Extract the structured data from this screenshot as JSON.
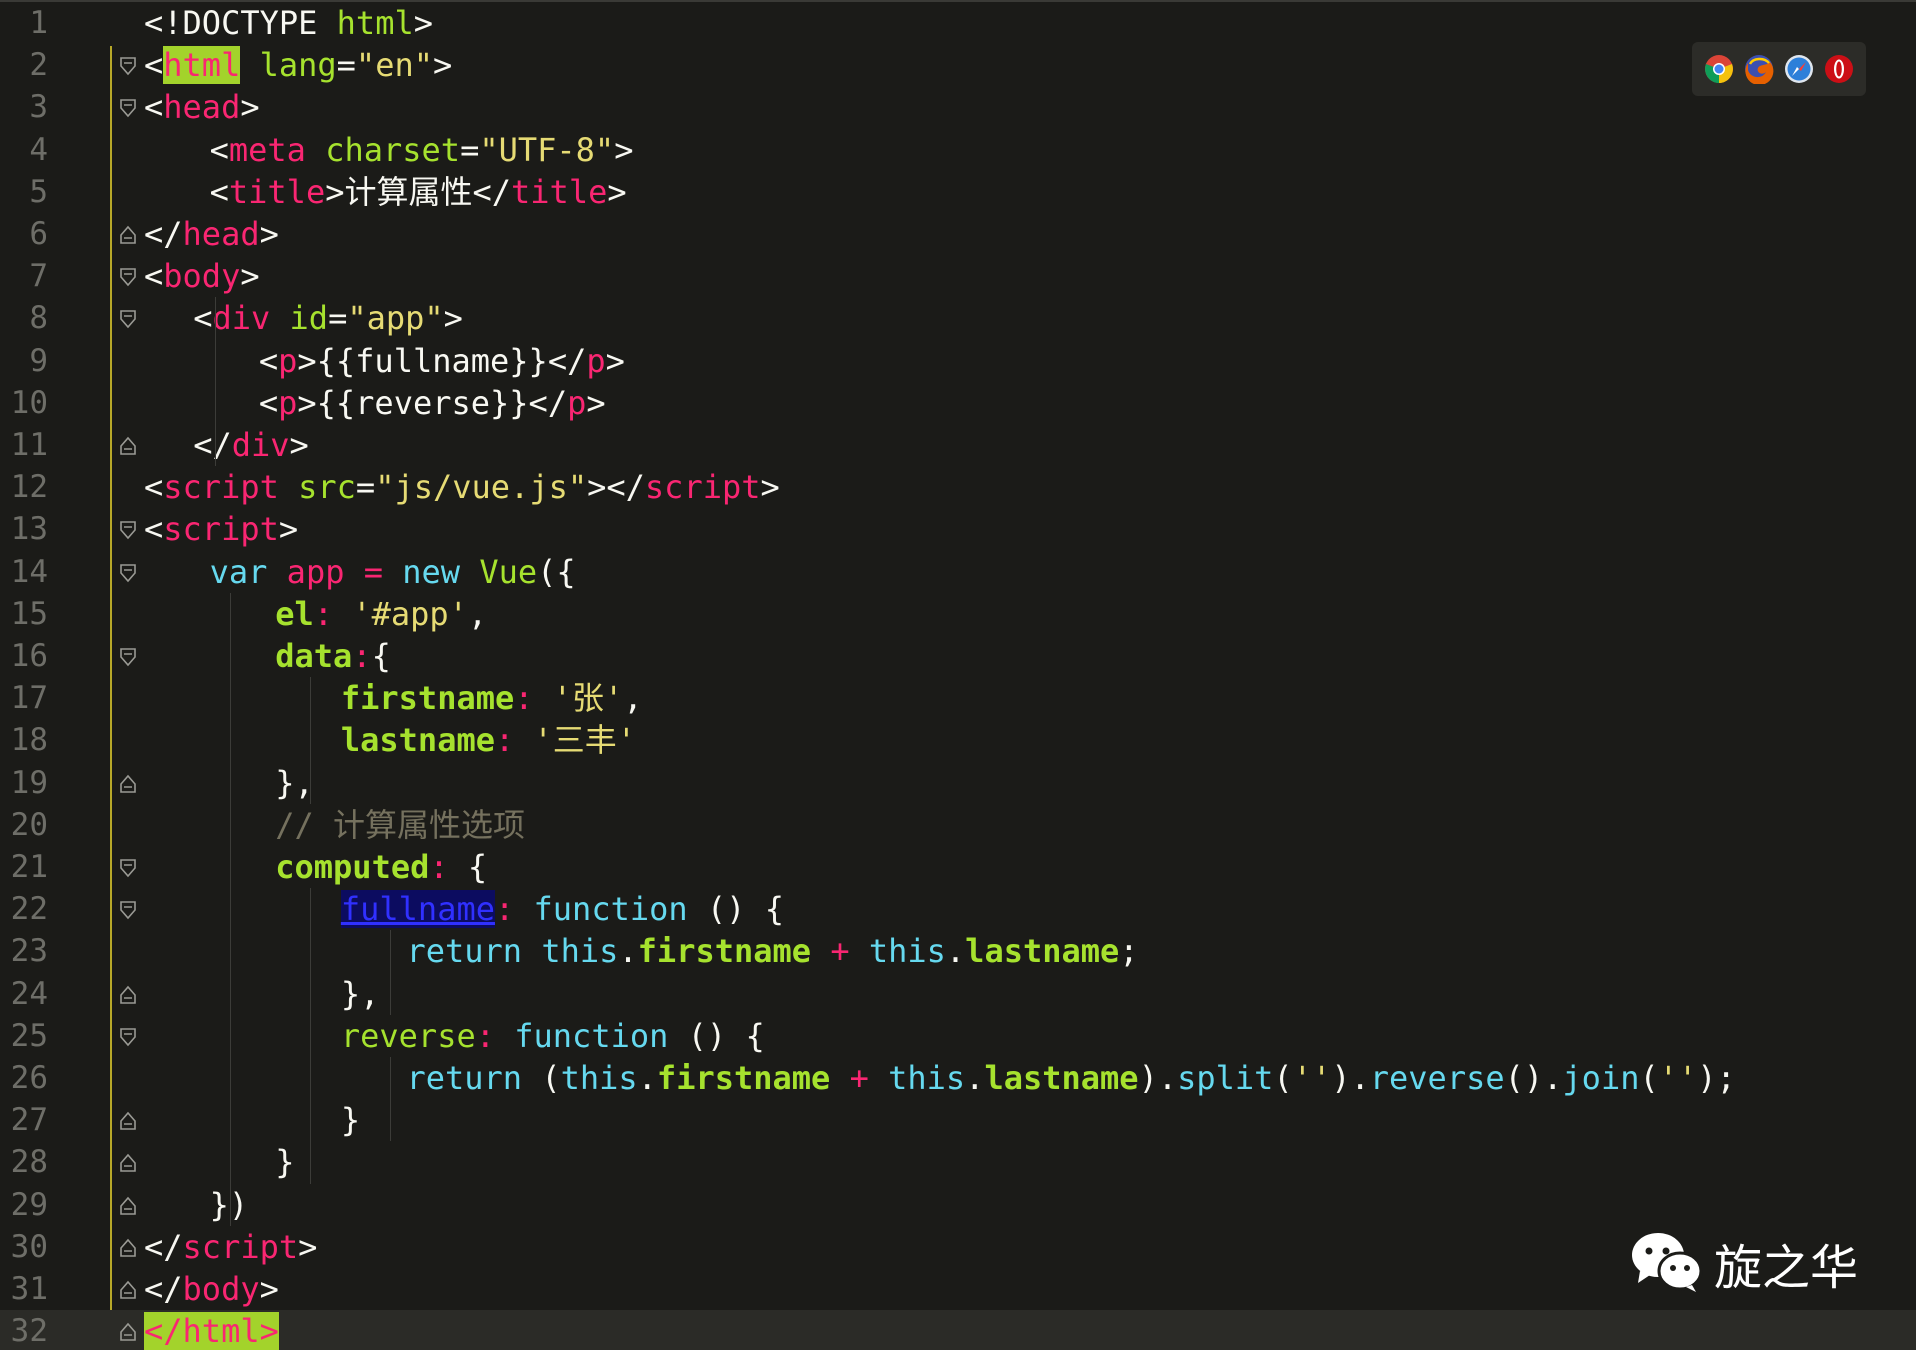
{
  "editor": {
    "current_line": 32,
    "colors": {
      "background": "#1b1b18",
      "tag": "#f92672",
      "attribute": "#a6e22e",
      "string": "#e6db74",
      "keyword": "#66d9ef",
      "comment": "#75715e"
    },
    "lines": [
      {
        "n": "1",
        "fold": "none",
        "indent": 0,
        "tokens": [
          [
            "punc",
            "<!DOCTYPE "
          ],
          [
            "attr",
            "html"
          ],
          [
            "punc",
            ">"
          ]
        ]
      },
      {
        "n": "2",
        "fold": "open",
        "indent": 0,
        "tokens": [
          [
            "punc",
            "<"
          ],
          [
            "hltag",
            "html"
          ],
          [
            "punc",
            " "
          ],
          [
            "attr",
            "lang"
          ],
          [
            "punc",
            "="
          ],
          [
            "str",
            "\"en\""
          ],
          [
            "punc",
            ">"
          ]
        ]
      },
      {
        "n": "3",
        "fold": "open",
        "indent": 0,
        "tokens": [
          [
            "punc",
            "<"
          ],
          [
            "tag",
            "head"
          ],
          [
            "punc",
            ">"
          ]
        ]
      },
      {
        "n": "4",
        "fold": "none",
        "indent": 2,
        "tokens": [
          [
            "punc",
            "<"
          ],
          [
            "tag",
            "meta"
          ],
          [
            "punc",
            " "
          ],
          [
            "attr",
            "charset"
          ],
          [
            "punc",
            "="
          ],
          [
            "str",
            "\"UTF-8\""
          ],
          [
            "punc",
            ">"
          ]
        ]
      },
      {
        "n": "5",
        "fold": "none",
        "indent": 2,
        "tokens": [
          [
            "punc",
            "<"
          ],
          [
            "tag",
            "title"
          ],
          [
            "punc",
            ">计算属性</"
          ],
          [
            "tag",
            "title"
          ],
          [
            "punc",
            ">"
          ]
        ]
      },
      {
        "n": "6",
        "fold": "close",
        "indent": 0,
        "tokens": [
          [
            "punc",
            "</"
          ],
          [
            "tag",
            "head"
          ],
          [
            "punc",
            ">"
          ]
        ]
      },
      {
        "n": "7",
        "fold": "open",
        "indent": 0,
        "tokens": [
          [
            "punc",
            "<"
          ],
          [
            "tag",
            "body"
          ],
          [
            "punc",
            ">"
          ]
        ]
      },
      {
        "n": "8",
        "fold": "open",
        "indent": 1.5,
        "tokens": [
          [
            "punc",
            "<"
          ],
          [
            "tag",
            "div"
          ],
          [
            "punc",
            " "
          ],
          [
            "attr",
            "id"
          ],
          [
            "punc",
            "="
          ],
          [
            "str",
            "\"app\""
          ],
          [
            "punc",
            ">"
          ]
        ]
      },
      {
        "n": "9",
        "fold": "none",
        "indent": 3.5,
        "tokens": [
          [
            "punc",
            "<"
          ],
          [
            "tag",
            "p"
          ],
          [
            "punc",
            ">{{fullname}}</"
          ],
          [
            "tag",
            "p"
          ],
          [
            "punc",
            ">"
          ]
        ]
      },
      {
        "n": "10",
        "fold": "none",
        "indent": 3.5,
        "tokens": [
          [
            "punc",
            "<"
          ],
          [
            "tag",
            "p"
          ],
          [
            "punc",
            ">{{reverse}}</"
          ],
          [
            "tag",
            "p"
          ],
          [
            "punc",
            ">"
          ]
        ]
      },
      {
        "n": "11",
        "fold": "close",
        "indent": 1.5,
        "tokens": [
          [
            "punc",
            "</"
          ],
          [
            "tag",
            "div"
          ],
          [
            "punc",
            ">"
          ]
        ]
      },
      {
        "n": "12",
        "fold": "none",
        "indent": 0,
        "tokens": [
          [
            "punc",
            "<"
          ],
          [
            "tag",
            "script"
          ],
          [
            "punc",
            " "
          ],
          [
            "attr",
            "src"
          ],
          [
            "punc",
            "="
          ],
          [
            "str",
            "\"js/vue.js\""
          ],
          [
            "punc",
            "></"
          ],
          [
            "tag",
            "script"
          ],
          [
            "punc",
            ">"
          ]
        ]
      },
      {
        "n": "13",
        "fold": "open",
        "indent": 0,
        "tokens": [
          [
            "punc",
            "<"
          ],
          [
            "tag",
            "script"
          ],
          [
            "punc",
            ">"
          ]
        ]
      },
      {
        "n": "14",
        "fold": "open",
        "indent": 2,
        "tokens": [
          [
            "kw",
            "var "
          ],
          [
            "op",
            "app"
          ],
          [
            "punc",
            " "
          ],
          [
            "op",
            "="
          ],
          [
            "punc",
            " "
          ],
          [
            "kw",
            "new "
          ],
          [
            "cls",
            "Vue"
          ],
          [
            "punc",
            "({"
          ]
        ]
      },
      {
        "n": "15",
        "fold": "none",
        "indent": 4,
        "tokens": [
          [
            "prop",
            "el"
          ],
          [
            "op",
            ":"
          ],
          [
            "punc",
            " "
          ],
          [
            "str",
            "'#app'"
          ],
          [
            "punc",
            ","
          ]
        ]
      },
      {
        "n": "16",
        "fold": "open",
        "indent": 4,
        "tokens": [
          [
            "prop",
            "data"
          ],
          [
            "op",
            ":"
          ],
          [
            "punc",
            "{"
          ]
        ]
      },
      {
        "n": "17",
        "fold": "none",
        "indent": 6,
        "tokens": [
          [
            "prop",
            "firstname"
          ],
          [
            "op",
            ":"
          ],
          [
            "punc",
            " "
          ],
          [
            "str",
            "'张'"
          ],
          [
            "punc",
            ","
          ]
        ]
      },
      {
        "n": "18",
        "fold": "none",
        "indent": 6,
        "tokens": [
          [
            "prop",
            "lastname"
          ],
          [
            "op",
            ":"
          ],
          [
            "punc",
            " "
          ],
          [
            "str",
            "'三丰'"
          ]
        ]
      },
      {
        "n": "19",
        "fold": "close",
        "indent": 4,
        "tokens": [
          [
            "punc",
            "},"
          ]
        ]
      },
      {
        "n": "20",
        "fold": "none",
        "indent": 4,
        "tokens": [
          [
            "com",
            "// 计算属性选项"
          ]
        ]
      },
      {
        "n": "21",
        "fold": "open",
        "indent": 4,
        "tokens": [
          [
            "prop",
            "computed"
          ],
          [
            "op",
            ":"
          ],
          [
            "punc",
            " {"
          ]
        ]
      },
      {
        "n": "22",
        "fold": "open",
        "indent": 6,
        "tokens": [
          [
            "link",
            "fullname"
          ],
          [
            "op",
            ":"
          ],
          [
            "punc",
            " "
          ],
          [
            "kw",
            "function"
          ],
          [
            "punc",
            " () {"
          ]
        ]
      },
      {
        "n": "23",
        "fold": "none",
        "indent": 8,
        "tokens": [
          [
            "kw",
            "return "
          ],
          [
            "kw",
            "this"
          ],
          [
            "punc",
            "."
          ],
          [
            "prop",
            "firstname"
          ],
          [
            "punc",
            " "
          ],
          [
            "op",
            "+"
          ],
          [
            "punc",
            " "
          ],
          [
            "kw",
            "this"
          ],
          [
            "punc",
            "."
          ],
          [
            "prop",
            "lastname"
          ],
          [
            "punc",
            ";"
          ]
        ]
      },
      {
        "n": "24",
        "fold": "close",
        "indent": 6,
        "tokens": [
          [
            "punc",
            "},"
          ]
        ]
      },
      {
        "n": "25",
        "fold": "open",
        "indent": 6,
        "tokens": [
          [
            "key",
            "reverse"
          ],
          [
            "op",
            ":"
          ],
          [
            "punc",
            " "
          ],
          [
            "kw",
            "function"
          ],
          [
            "punc",
            " () {"
          ]
        ]
      },
      {
        "n": "26",
        "fold": "none",
        "indent": 8,
        "tokens": [
          [
            "kw",
            "return "
          ],
          [
            "punc",
            "("
          ],
          [
            "kw",
            "this"
          ],
          [
            "punc",
            "."
          ],
          [
            "prop",
            "firstname"
          ],
          [
            "punc",
            " "
          ],
          [
            "op",
            "+"
          ],
          [
            "punc",
            " "
          ],
          [
            "kw",
            "this"
          ],
          [
            "punc",
            "."
          ],
          [
            "prop",
            "lastname"
          ],
          [
            "punc",
            ")."
          ],
          [
            "fn",
            "split"
          ],
          [
            "punc",
            "("
          ],
          [
            "str",
            "''"
          ],
          [
            "punc",
            ")."
          ],
          [
            "fn",
            "reverse"
          ],
          [
            "punc",
            "()."
          ],
          [
            "fn",
            "join"
          ],
          [
            "punc",
            "("
          ],
          [
            "str",
            "''"
          ],
          [
            "punc",
            ");"
          ]
        ]
      },
      {
        "n": "27",
        "fold": "close",
        "indent": 6,
        "tokens": [
          [
            "punc",
            "}"
          ]
        ]
      },
      {
        "n": "28",
        "fold": "close",
        "indent": 4,
        "tokens": [
          [
            "punc",
            "}"
          ]
        ]
      },
      {
        "n": "29",
        "fold": "close",
        "indent": 2,
        "tokens": [
          [
            "punc",
            "})"
          ]
        ]
      },
      {
        "n": "30",
        "fold": "close",
        "indent": 0,
        "tokens": [
          [
            "punc",
            "</"
          ],
          [
            "tag",
            "script"
          ],
          [
            "punc",
            ">"
          ]
        ]
      },
      {
        "n": "31",
        "fold": "close",
        "indent": 0,
        "tokens": [
          [
            "punc",
            "</"
          ],
          [
            "tag",
            "body"
          ],
          [
            "punc",
            ">"
          ]
        ]
      },
      {
        "n": "32",
        "fold": "close",
        "indent": 0,
        "tokens": [
          [
            "hltag",
            "</html>"
          ]
        ]
      }
    ]
  },
  "browser_bar": {
    "icons": [
      {
        "name": "chrome-icon",
        "color": "#dd4b39"
      },
      {
        "name": "firefox-icon",
        "color": "#e66000"
      },
      {
        "name": "safari-icon",
        "color": "#1e88e5"
      },
      {
        "name": "opera-icon",
        "color": "#cc0f16"
      }
    ]
  },
  "watermark": {
    "icon": "wechat-icon",
    "text": "旋之华"
  }
}
